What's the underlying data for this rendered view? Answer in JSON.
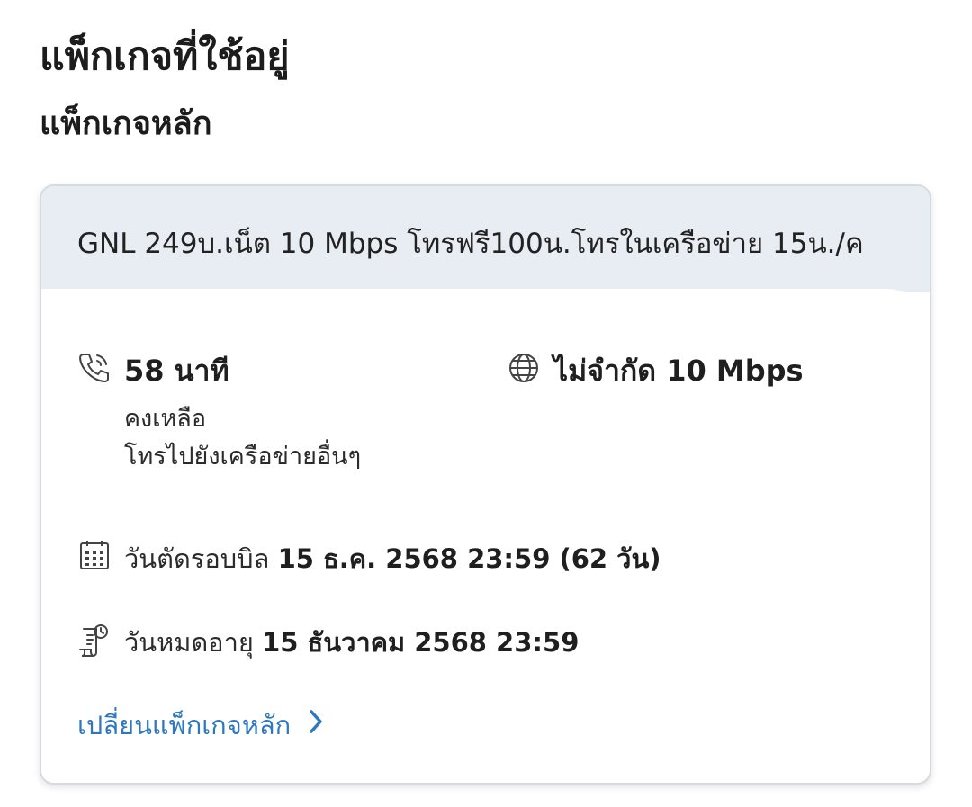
{
  "header": {
    "title": "แพ็กเกจที่ใช้อยู่",
    "section": "แพ็กเกจหลัก"
  },
  "package": {
    "name": "GNL 249บ.เน็ต 10 Mbps โทรฟรี100น.โทรในเครือข่าย 15น./ค",
    "call": {
      "icon": "phone-icon",
      "amount": "58 นาที",
      "remaining_label": "คงเหลือ",
      "scope": "โทรไปยังเครือข่ายอื่นๆ"
    },
    "data": {
      "icon": "globe-icon",
      "amount": "ไม่จำกัด 10 Mbps"
    },
    "billing": {
      "icon": "calendar-icon",
      "label": "วันตัดรอบบิล",
      "value": "15 ธ.ค. 2568 23:59 (62 วัน)"
    },
    "expiry": {
      "icon": "document-clock-icon",
      "label": "วันหมดอายุ",
      "value": "15 ธันวาคม 2568 23:59"
    },
    "change_link": {
      "label": "เปลี่ยนแพ็กเกจหลัก",
      "icon": "chevron-right-icon"
    }
  },
  "colors": {
    "header_bg": "#e8edf3",
    "link": "#2f78c0",
    "text": "#1f1f1f"
  }
}
